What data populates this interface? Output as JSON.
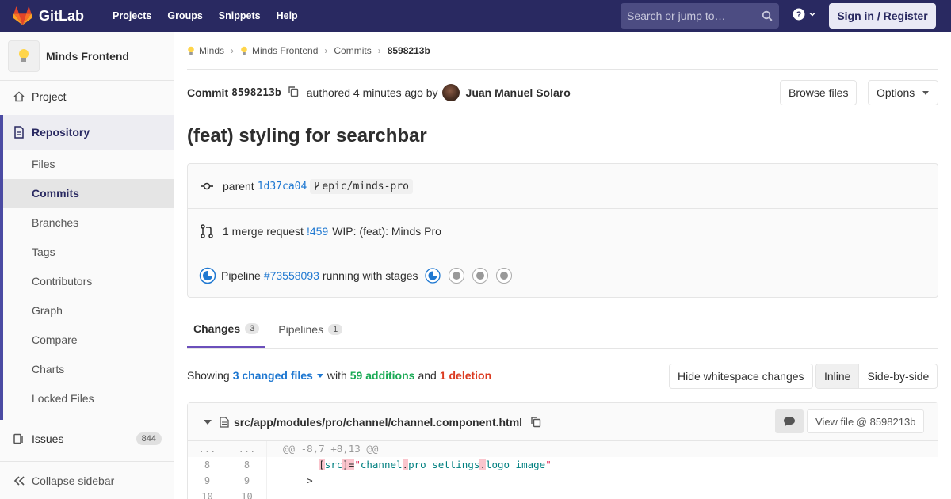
{
  "navbar": {
    "brand": "GitLab",
    "links": [
      "Projects",
      "Groups",
      "Snippets",
      "Help"
    ],
    "search_placeholder": "Search or jump to…",
    "signin_label": "Sign in / Register"
  },
  "sidebar": {
    "project_name": "Minds Frontend",
    "project_label": "Project",
    "repository_label": "Repository",
    "repo_items": [
      "Files",
      "Commits",
      "Branches",
      "Tags",
      "Contributors",
      "Graph",
      "Compare",
      "Charts",
      "Locked Files"
    ],
    "active_item": "Commits",
    "issues_label": "Issues",
    "issues_count": "844",
    "collapse_label": "Collapse sidebar"
  },
  "breadcrumb": {
    "items": [
      "Minds",
      "Minds Frontend",
      "Commits"
    ],
    "current": "8598213b"
  },
  "commit": {
    "label": "Commit",
    "sha": "8598213b",
    "authored_text": "authored 4 minutes ago by",
    "author": "Juan Manuel Solaro",
    "browse_files": "Browse files",
    "options": "Options",
    "title": "(feat) styling for searchbar"
  },
  "info": {
    "parent_label": "parent",
    "parent_sha": "1d37ca04",
    "branch": "epic/minds-pro",
    "mr_text": "1 merge request",
    "mr_link": "!459",
    "mr_title": "WIP: (feat): Minds Pro",
    "pipeline_label": "Pipeline",
    "pipeline_link": "#73558093",
    "pipeline_status": "running with stages"
  },
  "tabs": [
    {
      "label": "Changes",
      "count": "3"
    },
    {
      "label": "Pipelines",
      "count": "1"
    }
  ],
  "summary": {
    "showing": "Showing",
    "changed": "3 changed files",
    "with": "with",
    "additions": "59 additions",
    "and": "and",
    "deletions": "1 deletion",
    "hide_ws": "Hide whitespace changes",
    "inline": "Inline",
    "side_by_side": "Side-by-side"
  },
  "file": {
    "path": "src/app/modules/pro/channel/channel.component.html",
    "view_file": "View file @ 8598213b"
  },
  "diff": {
    "hunk_old": "...",
    "hunk_new": "...",
    "hunk_text": "@@ -8,7 +8,13 @@",
    "lines": [
      {
        "old": "8",
        "new": "8"
      },
      {
        "old": "9",
        "new": "9"
      },
      {
        "old": "10",
        "new": "10"
      }
    ],
    "line8": {
      "indent": "      ",
      "open": "[",
      "attr": "src",
      "close": "]",
      "eq": "=",
      "q1": "\"",
      "v1": "channel",
      "dot1": ".",
      "v2": "pro_settings",
      "dot2": ".",
      "v3": "logo_image",
      "q2": "\""
    },
    "line9": "    >"
  },
  "colors": {
    "navbar": "#292961",
    "link": "#1f78d1",
    "addition": "#1aaa55",
    "deletion": "#db3b21",
    "tab_active": "#6b4fbb"
  }
}
